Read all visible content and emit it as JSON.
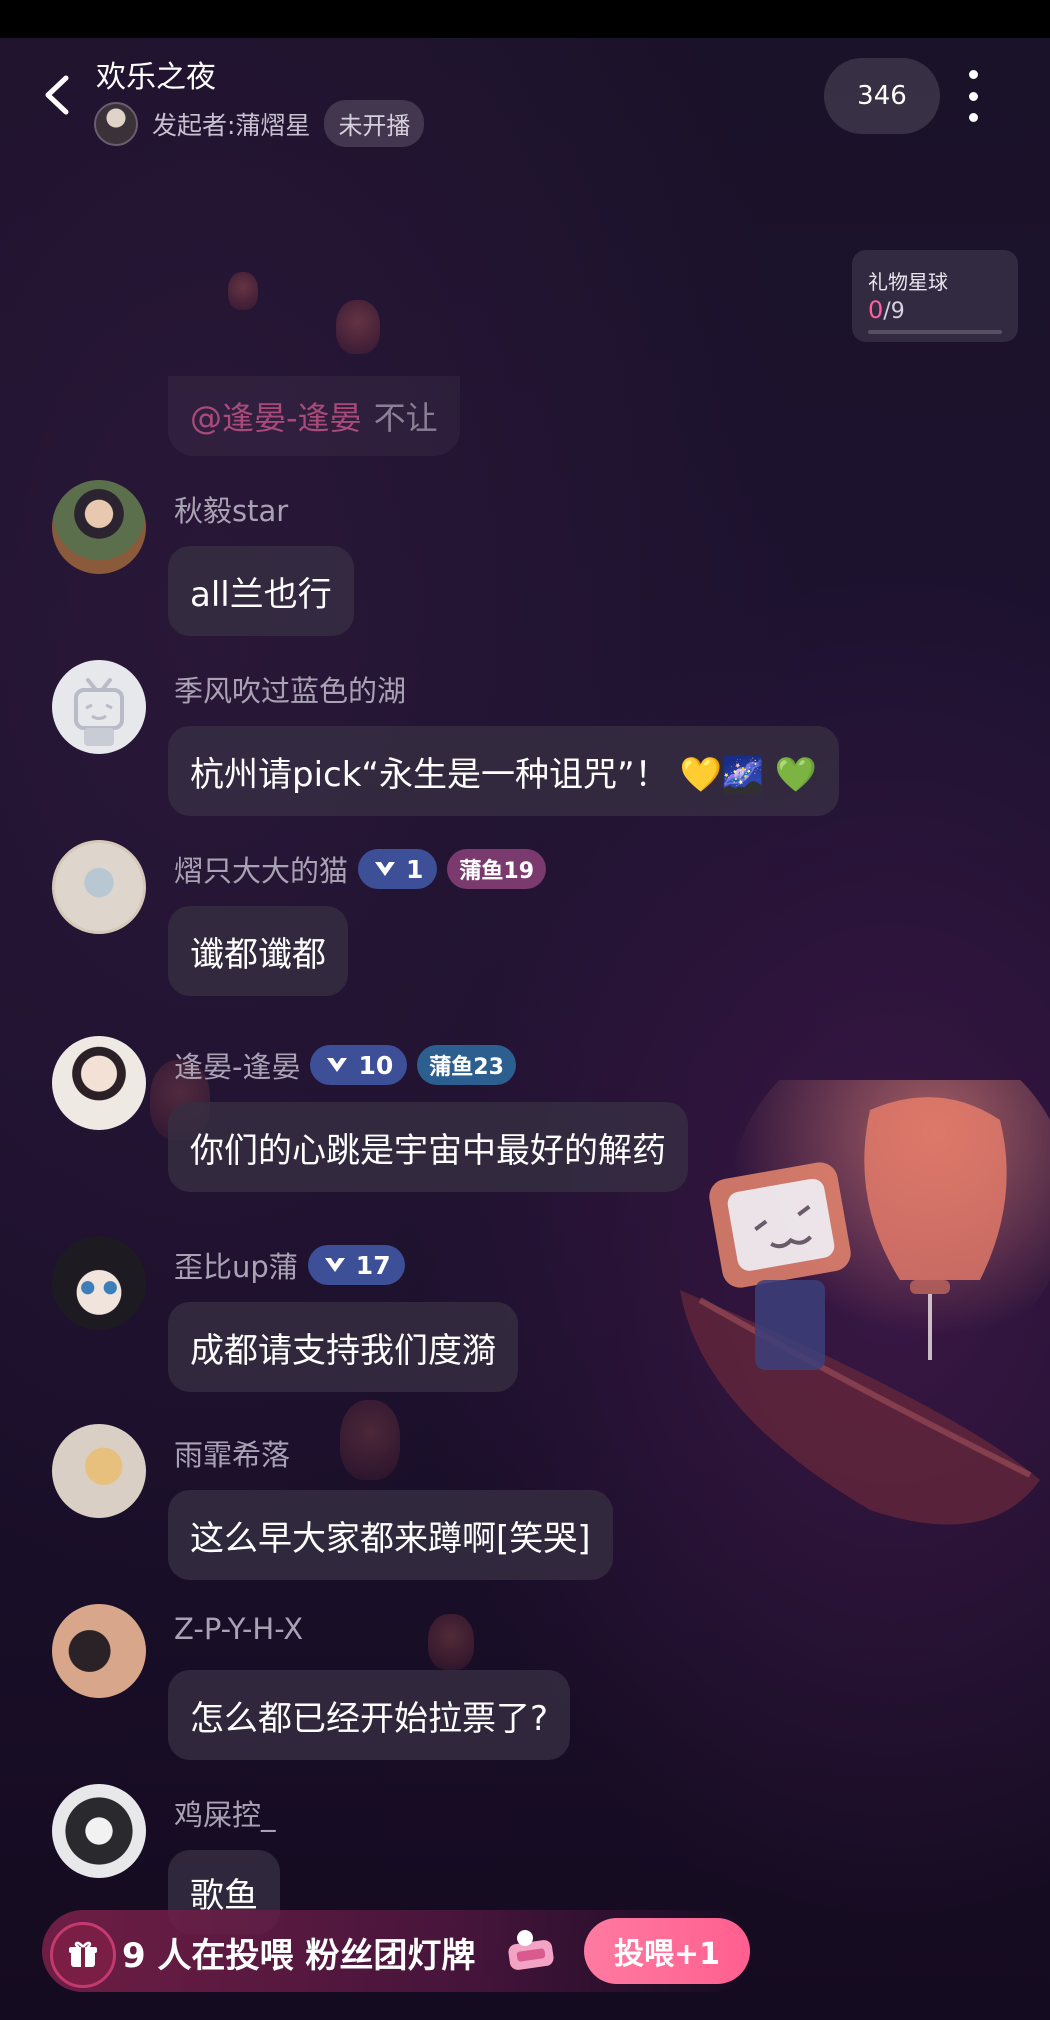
{
  "header": {
    "room_title": "欢乐之夜",
    "host_label": "发起者:蒲熠星",
    "live_status": "未开播",
    "viewer_count": "346"
  },
  "gift_planet": {
    "title": "礼物星球",
    "current": "0",
    "total": "/9"
  },
  "partial_message": {
    "mention": "@逢晏-逢晏",
    "text": "不让"
  },
  "messages": [
    {
      "nickname": "秋毅star",
      "text": "all兰也行",
      "badges": []
    },
    {
      "nickname": "季风吹过蓝色的湖",
      "text": "杭州请pick“永生是一种诅咒”！ 💛🌌 💚",
      "badges": []
    },
    {
      "nickname": "熠只大大的猫",
      "text": "谶都谶都",
      "level": "1",
      "fan": "蒲鱼19"
    },
    {
      "nickname": "逢晏-逢晏",
      "text": "你们的心跳是宇宙中最好的解药",
      "level": "10",
      "fan": "蒲鱼23"
    },
    {
      "nickname": "歪比up蒲",
      "text": "成都请支持我们度漪",
      "level": "17"
    },
    {
      "nickname": "雨霏希落",
      "text": "这么早大家都来蹲啊[笑哭]"
    },
    {
      "nickname": "Z-P-Y-H-X",
      "text": "怎么都已经开始拉票了?"
    },
    {
      "nickname": "鸡屎控_",
      "text": "歌鱼"
    }
  ],
  "bottom_bar": {
    "voting_text": "9 人在投喂 粉丝团灯牌",
    "vote_button": "投喂+1"
  },
  "colors": {
    "accent_pink": "#ff5f9e",
    "level_badge": "#3d4f96",
    "fan_badge_purple": "#7a3a6d",
    "fan_badge_blue": "#2c5f8f"
  }
}
